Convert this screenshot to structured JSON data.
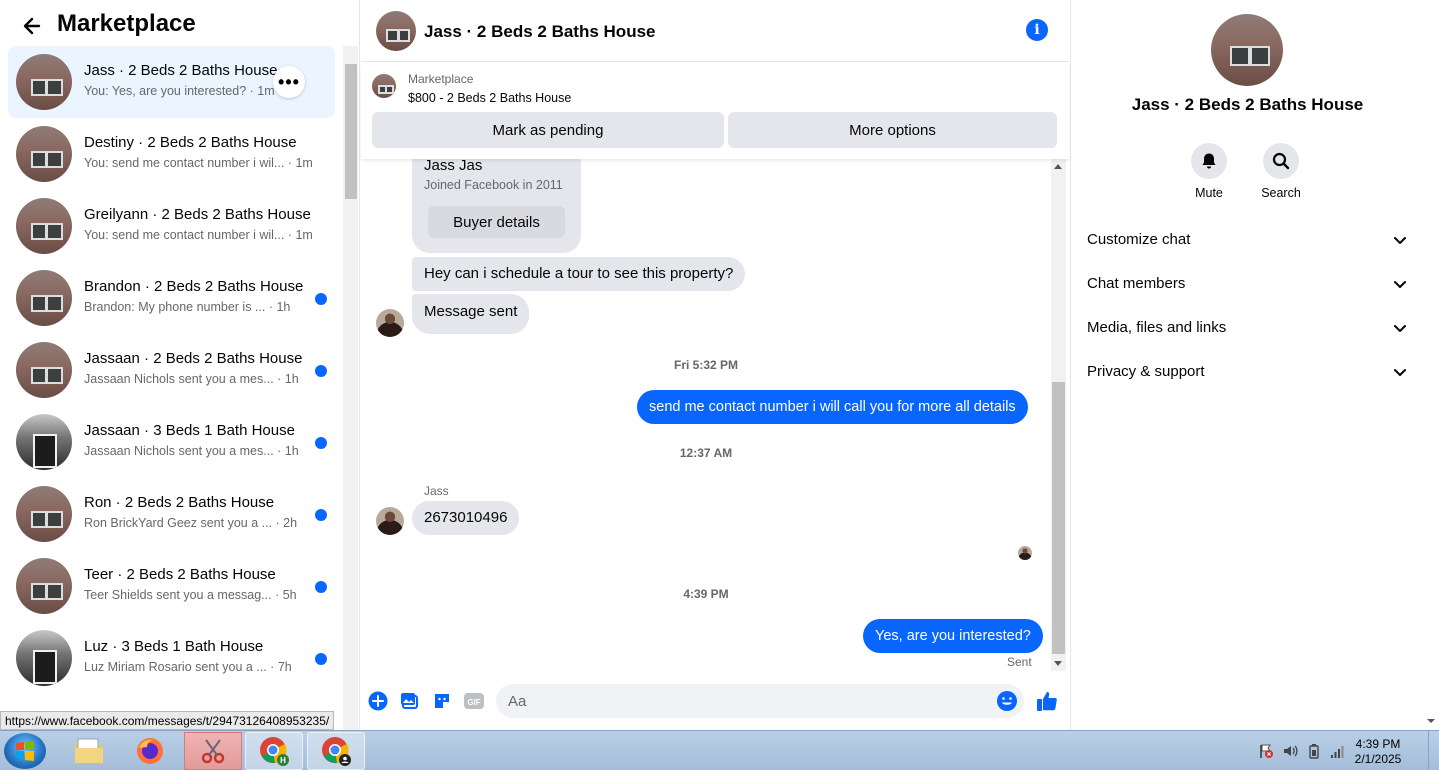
{
  "left": {
    "title": "Marketplace",
    "conversations": [
      {
        "name": "Jass · 2 Beds 2 Baths House",
        "snippet": "You: Yes, are you interested? · 1m",
        "unread": false,
        "active": true,
        "thumb": "house"
      },
      {
        "name": "Destiny · 2 Beds 2 Baths House",
        "snippet": "You: send me contact number i wil... · 1m",
        "unread": false,
        "active": false,
        "thumb": "house"
      },
      {
        "name": "Greilyann · 2 Beds 2 Baths House",
        "snippet": "You: send me contact number i wil... · 1m",
        "unread": false,
        "active": false,
        "thumb": "house"
      },
      {
        "name": "Brandon · 2 Beds 2 Baths House",
        "snippet": "Brandon: My phone number is ... · 1h",
        "unread": true,
        "active": false,
        "thumb": "house"
      },
      {
        "name": "Jassaan · 2 Beds 2 Baths House",
        "snippet": "Jassaan Nichols sent you a mes... · 1h",
        "unread": true,
        "active": false,
        "thumb": "house"
      },
      {
        "name": "Jassaan · 3 Beds 1 Bath House",
        "snippet": "Jassaan Nichols sent you a mes... · 1h",
        "unread": true,
        "active": false,
        "thumb": "dark"
      },
      {
        "name": "Ron · 2 Beds 2 Baths House",
        "snippet": "Ron BrickYard Geez sent you a ... · 2h",
        "unread": true,
        "active": false,
        "thumb": "house"
      },
      {
        "name": "Teer · 2 Beds 2 Baths House",
        "snippet": "Teer Shields sent you a messag... · 5h",
        "unread": true,
        "active": false,
        "thumb": "house"
      },
      {
        "name": "Luz · 3 Beds 1 Bath House",
        "snippet": "Luz Miriam Rosario sent you a ... · 7h",
        "unread": true,
        "active": false,
        "thumb": "dark"
      }
    ],
    "more_label": "•••"
  },
  "chat": {
    "title": "Jass · 2 Beds 2 Baths House",
    "info_label": "i",
    "listing_source": "Marketplace",
    "listing_price": "$800 - 2 Beds 2 Baths House",
    "mark_pending_label": "Mark as pending",
    "more_options_label": "More options",
    "buyer_name": "Jass Jas",
    "buyer_joined": "Joined Facebook in 2011",
    "buyer_details_label": "Buyer details",
    "messages": {
      "m1": "Hey can i schedule a tour to see this property?",
      "m2": "Message sent",
      "ts1": "Fri 5:32 PM",
      "m3": "send me contact number i will call you for more all details",
      "ts2": "12:37 AM",
      "sender_label": "Jass",
      "m4": "2673010496",
      "ts3": "4:39 PM",
      "m5": "Yes, are you interested?",
      "sent_status": "Sent"
    },
    "composer_placeholder": "Aa",
    "gif_label": "GIF"
  },
  "right": {
    "title": "Jass · 2 Beds 2 Baths House",
    "mute_label": "Mute",
    "search_label": "Search",
    "sections": [
      "Customize chat",
      "Chat members",
      "Media, files and links",
      "Privacy & support"
    ]
  },
  "status_url": "https://www.facebook.com/messages/t/29473126408953235/",
  "taskbar": {
    "time": "4:39 PM",
    "date": "2/1/2025",
    "chrome_badge": "H"
  },
  "colors": {
    "accent": "#0866ff",
    "bubble_in": "#e4e6eb",
    "active_row": "#ebf5ff"
  }
}
